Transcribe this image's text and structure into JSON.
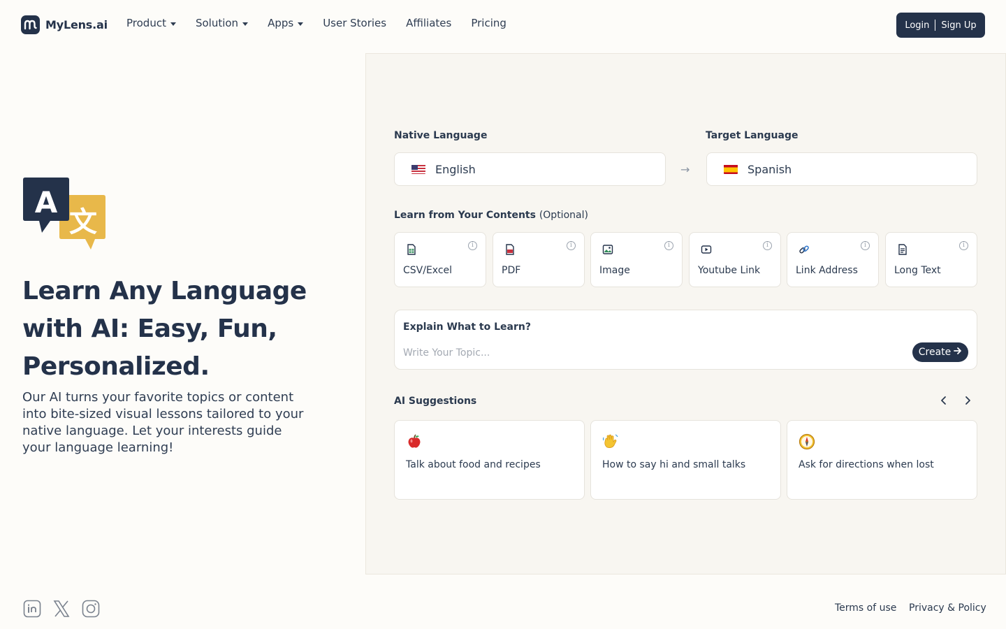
{
  "brand": {
    "name": "MyLens.ai",
    "logo_icon": "mylens-logo-icon"
  },
  "nav": {
    "items": [
      {
        "label": "Product",
        "dropdown": true
      },
      {
        "label": "Solution",
        "dropdown": true
      },
      {
        "label": "Apps",
        "dropdown": true
      },
      {
        "label": "User Stories",
        "dropdown": false
      },
      {
        "label": "Affiliates",
        "dropdown": false
      },
      {
        "label": "Pricing",
        "dropdown": false
      }
    ]
  },
  "auth": {
    "login": "Login",
    "signup": "Sign Up"
  },
  "hero": {
    "icon": "translate-icon",
    "title": "Learn Any Language with AI: Easy, Fun, Personalized.",
    "subtitle": "Our AI turns your favorite topics or content into bite-sized visual lessons tailored to your native language. Let your interests guide your language learning!"
  },
  "languages": {
    "native_label": "Native Language",
    "native_value": "English",
    "target_label": "Target Language",
    "target_value": "Spanish",
    "arrow": "→"
  },
  "sources": {
    "label": "Learn from Your Contents",
    "optional": "(Optional)",
    "items": [
      {
        "label": "CSV/Excel",
        "icon": "spreadsheet-icon"
      },
      {
        "label": "PDF",
        "icon": "pdf-icon"
      },
      {
        "label": "Image",
        "icon": "image-icon"
      },
      {
        "label": "Youtube Link",
        "icon": "video-icon"
      },
      {
        "label": "Link Address",
        "icon": "link-icon"
      },
      {
        "label": "Long Text",
        "icon": "document-icon"
      }
    ]
  },
  "explain": {
    "title": "Explain What to Learn?",
    "placeholder": "Write Your Topic...",
    "create": "Create"
  },
  "suggestions": {
    "label": "AI Suggestions",
    "items": [
      {
        "label": "Talk about food and recipes",
        "icon": "apple-icon"
      },
      {
        "label": "How to say hi and small talks",
        "icon": "waving-hand-icon"
      },
      {
        "label": "Ask for directions when lost",
        "icon": "compass-icon"
      }
    ]
  },
  "footer": {
    "social": [
      "linkedin-icon",
      "x-icon",
      "instagram-icon"
    ],
    "terms": "Terms of use",
    "privacy": "Privacy & Policy"
  },
  "colors": {
    "primary": "#24324a",
    "accent": "#e8b84a",
    "background": "#fdfcf9",
    "panel": "#f8f6f1"
  }
}
